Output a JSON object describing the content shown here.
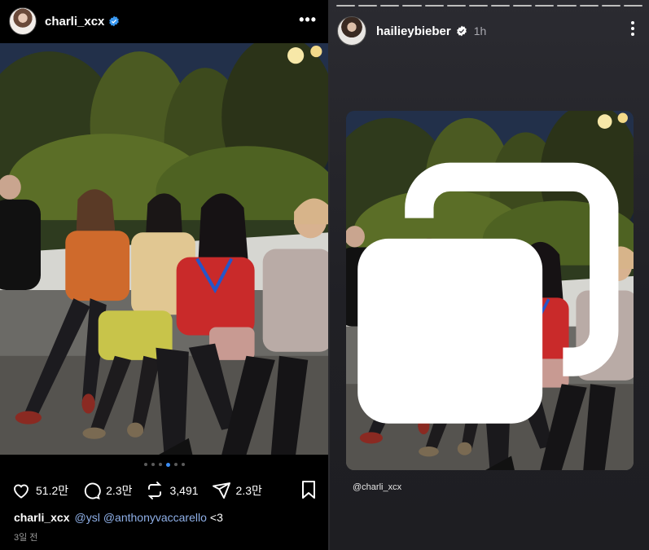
{
  "post": {
    "username": "charli_xcx",
    "more_label": "•••",
    "carousel": {
      "count": 6,
      "active_index": 3
    },
    "actions": {
      "likes": "51.2만",
      "comments": "2.3만",
      "reposts": "3,491",
      "shares": "2.3만"
    },
    "caption": {
      "username": "charli_xcx",
      "mention1": "@ysl",
      "mention2": "@anthonyvaccarello",
      "text": "<3"
    },
    "time": "3일 전"
  },
  "story": {
    "segments": 14,
    "username": "hailieybieber",
    "time": "1h",
    "mention": "@charli_xcx"
  },
  "colors": {
    "verified": "#3897f0",
    "accent": "#3b8df5",
    "mention": "#8fb0e8"
  },
  "icons": [
    "heart-icon",
    "comment-icon",
    "repost-icon",
    "share-icon",
    "bookmark-icon",
    "verified-icon",
    "more-icon",
    "multi-photo-icon"
  ]
}
